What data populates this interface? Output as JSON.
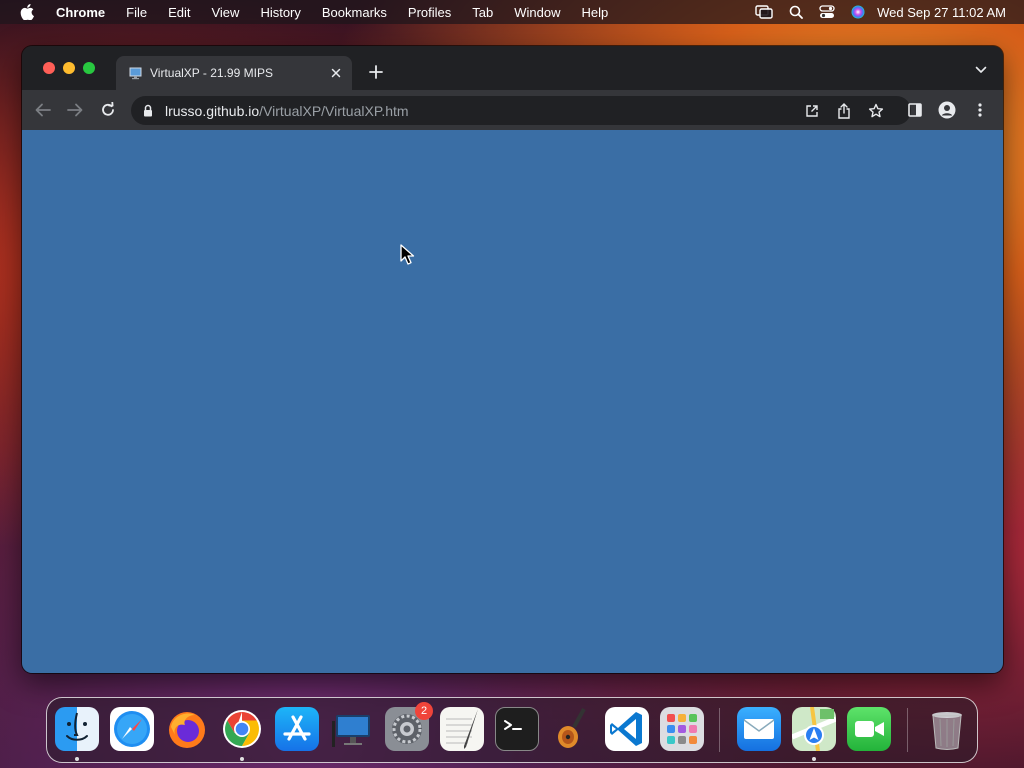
{
  "menubar": {
    "app_name": "Chrome",
    "items": [
      "File",
      "Edit",
      "View",
      "History",
      "Bookmarks",
      "Profiles",
      "Tab",
      "Window",
      "Help"
    ],
    "clock": "Wed Sep 27  11:02 AM",
    "status_icons": [
      "screen-mirroring-icon",
      "spotlight-search-icon",
      "control-center-icon",
      "siri-icon"
    ]
  },
  "browser": {
    "tab": {
      "title": "VirtualXP - 21.99 MIPS",
      "favicon": "computer-icon"
    },
    "address": {
      "host": "lrusso.github.io",
      "path": "/VirtualXP/VirtualXP.htm"
    },
    "content_color": "#3a6ea5"
  },
  "dock": {
    "apps": [
      {
        "name": "Finder",
        "icon": "finder-icon",
        "running": true
      },
      {
        "name": "Safari",
        "icon": "safari-icon",
        "running": false
      },
      {
        "name": "Firefox",
        "icon": "firefox-icon",
        "running": false
      },
      {
        "name": "Google Chrome",
        "icon": "chrome-icon",
        "running": true
      },
      {
        "name": "App Store",
        "icon": "app-store-icon",
        "running": false
      },
      {
        "name": "Remote Desktop",
        "icon": "remote-desktop-icon",
        "running": false
      },
      {
        "name": "System Settings",
        "icon": "system-settings-icon",
        "running": false,
        "badge": "2"
      },
      {
        "name": "TextEdit",
        "icon": "textedit-icon",
        "running": false
      },
      {
        "name": "Terminal",
        "icon": "terminal-icon",
        "running": false
      },
      {
        "name": "GarageBand",
        "icon": "garageband-icon",
        "running": false
      },
      {
        "name": "Visual Studio Code",
        "icon": "vscode-icon",
        "running": false
      },
      {
        "name": "Launchpad",
        "icon": "launchpad-icon",
        "running": false
      },
      {
        "name": "Mail",
        "icon": "mail-icon",
        "running": false
      },
      {
        "name": "Maps",
        "icon": "maps-icon",
        "running": true
      },
      {
        "name": "FaceTime",
        "icon": "facetime-icon",
        "running": false
      },
      {
        "name": "Trash",
        "icon": "trash-icon",
        "running": false
      }
    ]
  }
}
